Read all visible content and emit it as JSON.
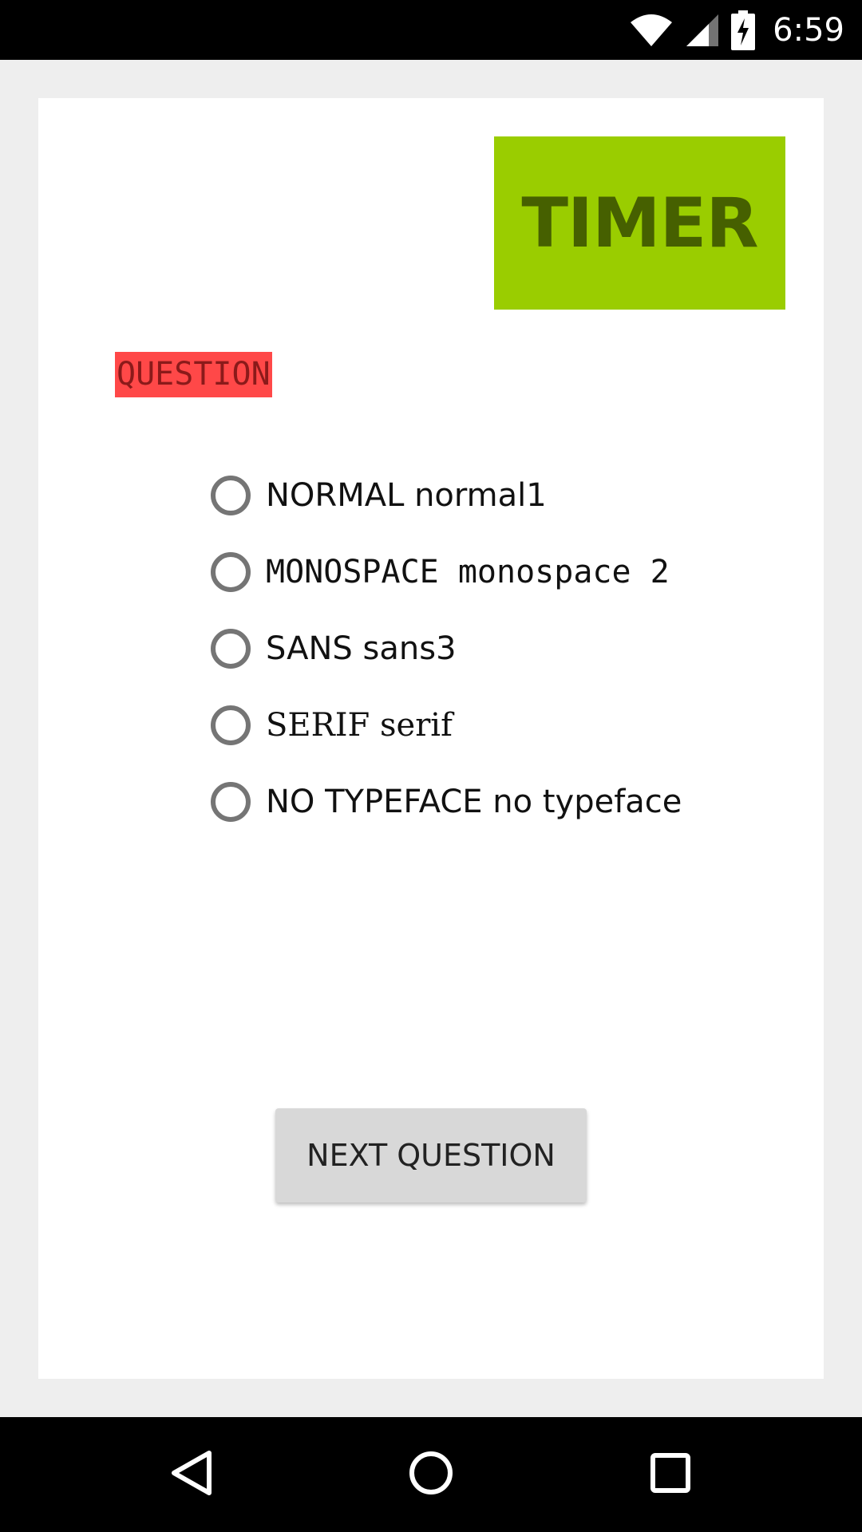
{
  "status_bar": {
    "time": "6:59",
    "icons": [
      "wifi-icon",
      "cell-signal-icon",
      "battery-charging-icon"
    ]
  },
  "timer": {
    "label": "TIMER",
    "color": "#9acd00"
  },
  "question": {
    "label": "QUESTION",
    "color": "#ff4848"
  },
  "options": [
    {
      "label": "NORMAL normal1",
      "selected": false
    },
    {
      "label": "MONOSPACE monospace 2",
      "selected": false
    },
    {
      "label": "SANS sans3",
      "selected": false
    },
    {
      "label": "SERIF serif",
      "selected": false
    },
    {
      "label": "NO TYPEFACE no typeface",
      "selected": false
    }
  ],
  "next_button": {
    "label": "NEXT QUESTION"
  },
  "nav_bar": {
    "icons": [
      "back-icon",
      "home-icon",
      "recents-icon"
    ]
  }
}
